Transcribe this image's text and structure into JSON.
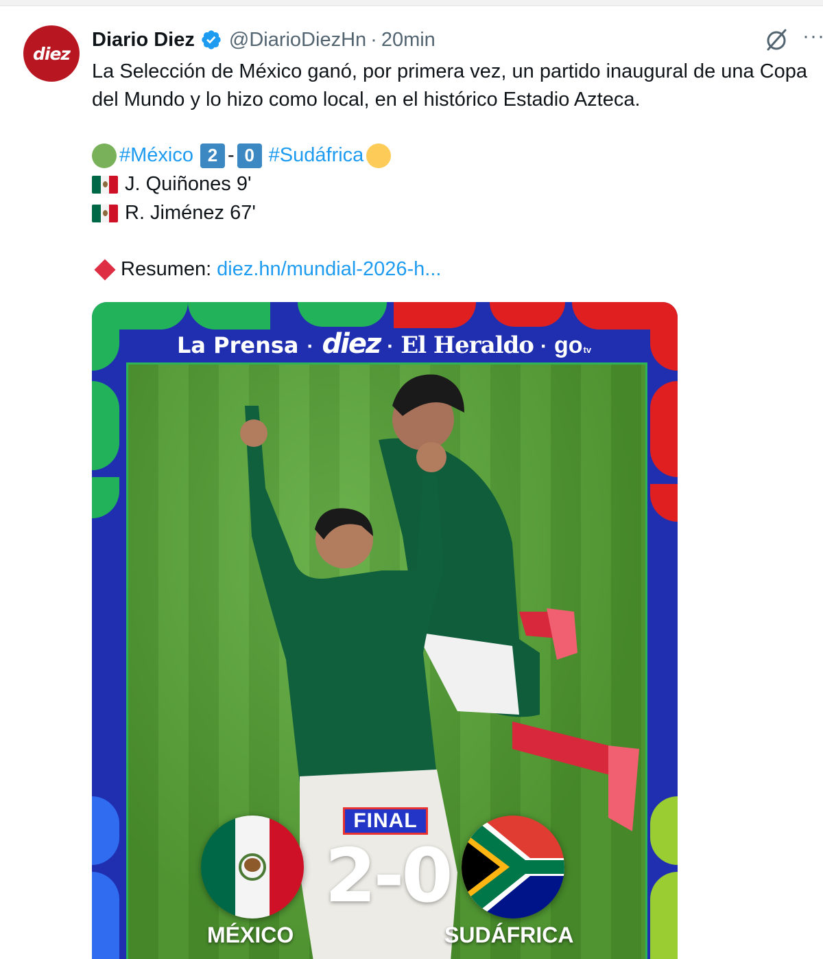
{
  "tweet": {
    "author_name": "Diario Diez",
    "handle": "@DiarioDiezHn",
    "separator": "·",
    "time": "20min",
    "avatar_text": "diez",
    "text": "La Selección de México ganó, por primera vez, un partido inaugural de una Copa del Mundo y lo hizo como local, en el histórico Estadio Azteca.",
    "score_line": {
      "hashtag_home": "#México",
      "home_goals": "2",
      "dash": "-",
      "away_goals": "0",
      "hashtag_away": "#Sudáfrica"
    },
    "goals": [
      "J. Quiñones 9'",
      "R. Jiménez 67'"
    ],
    "summary_label": "Resumen:",
    "summary_link": "diez.hn/mundial-2026-h..."
  },
  "media": {
    "brands": {
      "la_prensa": "La Prensa",
      "dot": "·",
      "diez": "diez",
      "el_heraldo": "El Heraldo",
      "go": "go",
      "tv": "tv"
    },
    "status": "FINAL",
    "score": "2-0",
    "home_team": "MÉXICO",
    "away_team": "SUDÁFRICA"
  },
  "icons": {
    "verified": "verified-badge-icon",
    "grok": "grok-icon",
    "more": "more-icon"
  },
  "colors": {
    "link": "#1d9bf0",
    "secondary_text": "#536471",
    "frame_blue": "#1f2fb0",
    "brand_red": "#b81722"
  }
}
